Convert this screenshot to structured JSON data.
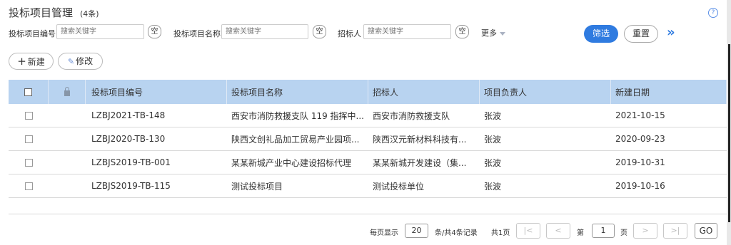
{
  "header": {
    "title": "投标项目管理",
    "count": "(4条)",
    "help_icon": "question-circle-icon"
  },
  "filters": {
    "code": {
      "label": "投标项目编号",
      "placeholder": "搜索关键字",
      "clear": "空"
    },
    "name": {
      "label": "投标项目名称",
      "placeholder": "搜索关键字",
      "clear": "空"
    },
    "bidder": {
      "label": "招标人",
      "placeholder": "搜索关键字",
      "clear": "空"
    },
    "more": "更多",
    "filter_button": "筛选",
    "reset_button": "重置",
    "expand_icon": "»"
  },
  "toolbar": {
    "new_icon": "+",
    "new_label": "新建",
    "edit_icon": "✎",
    "edit_label": "修改"
  },
  "table": {
    "columns": [
      "投标项目编号",
      "投标项目名称",
      "招标人",
      "项目负责人",
      "新建日期"
    ],
    "rows": [
      {
        "code": "LZBJ2021-TB-148",
        "name": "西安市消防救援支队 119 指挥中...",
        "bidder": "西安市消防救援支队",
        "owner": "张波",
        "date": "2021-10-15"
      },
      {
        "code": "LZBJ2020-TB-130",
        "name": "陕西文创礼品加工贸易产业园项...",
        "bidder": "陕西汉元新材料科技有...",
        "owner": "张波",
        "date": "2020-09-23"
      },
      {
        "code": "LZBJS2019-TB-001",
        "name": "某某新城产业中心建设招标代理",
        "bidder": "某某新城开发建设（集...",
        "owner": "张波",
        "date": "2019-10-31"
      },
      {
        "code": "LZBJS2019-TB-115",
        "name": "测试投标项目",
        "bidder": "测试投标单位",
        "owner": "张波",
        "date": "2019-10-16"
      }
    ]
  },
  "pagination": {
    "per_page_label": "每页显示",
    "per_page_value": "20",
    "records_text": "条/共4条记录",
    "total_pages": "共1页",
    "first": "|<",
    "prev": "<",
    "page_label": "第",
    "page_value": "1",
    "page_suffix": "页",
    "next": ">",
    "last": ">|",
    "go": "GO"
  }
}
